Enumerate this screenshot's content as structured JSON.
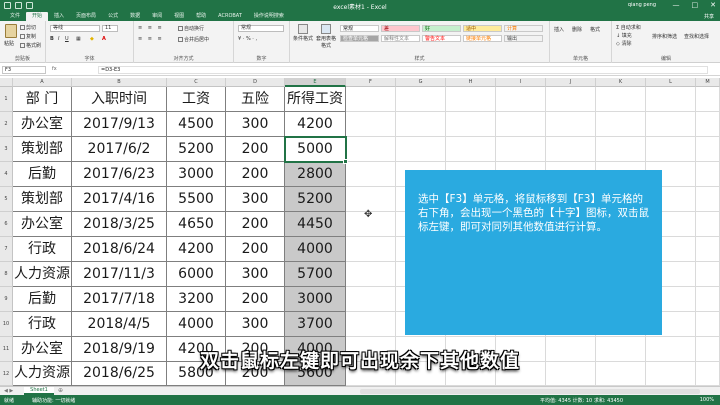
{
  "app": {
    "title": "excel素材1 - Excel",
    "user": "qiang peng",
    "window_controls": [
      "—",
      "□",
      "✕"
    ]
  },
  "ribbon": {
    "tabs": [
      "文件",
      "开始",
      "插入",
      "页面布局",
      "公式",
      "数据",
      "审阅",
      "视图",
      "帮助",
      "ACROBAT"
    ],
    "active_tab_index": 1,
    "tell_me": "操作说明搜索",
    "share": "共享",
    "clipboard": {
      "paste": "粘贴",
      "cut": "剪切",
      "copy": "复制",
      "format_painter": "格式刷",
      "label": "剪贴板"
    },
    "font": {
      "name": "等线",
      "size": "11",
      "label": "字体"
    },
    "alignment": {
      "wrap": "自动换行",
      "merge": "合并后居中",
      "label": "对齐方式"
    },
    "number": {
      "format": "常规",
      "label": "数字"
    },
    "styles": {
      "conditional": "条件格式",
      "table": "套用表格格式",
      "cells": [
        {
          "name": "常规",
          "bg": "#ffffff",
          "fg": "#222222"
        },
        {
          "name": "差",
          "bg": "#ffc7ce",
          "fg": "#9c0006"
        },
        {
          "name": "好",
          "bg": "#c6efce",
          "fg": "#006100"
        },
        {
          "name": "适中",
          "bg": "#ffeb9c",
          "fg": "#9c5700"
        },
        {
          "name": "计算",
          "bg": "#f2f2f2",
          "fg": "#fa7d00"
        },
        {
          "name": "检查单元格",
          "bg": "#a5a5a5",
          "fg": "#ffffff"
        },
        {
          "name": "解释性文本",
          "bg": "#ffffff",
          "fg": "#7f7f7f"
        },
        {
          "name": "警告文本",
          "bg": "#ffffff",
          "fg": "#ff0000"
        },
        {
          "name": "链接单元格",
          "bg": "#ffffff",
          "fg": "#fa7d00"
        },
        {
          "name": "输出",
          "bg": "#f2f2f2",
          "fg": "#3f3f3f"
        }
      ],
      "label": "样式"
    },
    "cells_group": {
      "insert": "插入",
      "delete": "删除",
      "format": "格式",
      "label": "单元格"
    },
    "editing": {
      "autosum": "自动求和",
      "fill": "填充",
      "clear": "清除",
      "sort": "排序和筛选",
      "find": "查找和选择",
      "label": "编辑"
    }
  },
  "formula_bar": {
    "name_box": "F3",
    "fx": "fx",
    "formula": "=D3-E3"
  },
  "columns": [
    "A",
    "B",
    "C",
    "D",
    "E",
    "F",
    "G",
    "H",
    "I",
    "J",
    "K",
    "L",
    "M",
    "N",
    "O",
    "P",
    "Q",
    "R"
  ],
  "rows": [
    "1",
    "2",
    "3",
    "4",
    "5",
    "6",
    "7",
    "8",
    "9",
    "10",
    "11",
    "12"
  ],
  "table": {
    "headers": [
      "部 门",
      "入职时间",
      "工资",
      "五险",
      "所得工资"
    ],
    "rows": [
      [
        "办公室",
        "2017/9/13",
        "4500",
        "300",
        "4200"
      ],
      [
        "策划部",
        "2017/6/2",
        "5200",
        "200",
        "5000"
      ],
      [
        "后勤",
        "2017/6/23",
        "3000",
        "200",
        "2800"
      ],
      [
        "策划部",
        "2017/4/16",
        "5500",
        "300",
        "5200"
      ],
      [
        "办公室",
        "2018/3/25",
        "4650",
        "200",
        "4450"
      ],
      [
        "行政",
        "2018/6/24",
        "4200",
        "200",
        "4000"
      ],
      [
        "人力资源",
        "2017/11/3",
        "6000",
        "300",
        "5700"
      ],
      [
        "后勤",
        "2017/7/18",
        "3200",
        "200",
        "3000"
      ],
      [
        "行政",
        "2018/4/5",
        "4000",
        "300",
        "3700"
      ],
      [
        "办公室",
        "2018/9/19",
        "4200",
        "200",
        "4000"
      ],
      [
        "人力资源",
        "2018/6/25",
        "5800",
        "200",
        "5600"
      ]
    ]
  },
  "note": {
    "text": "选中【F3】单元格，将鼠标移到【F3】单元格的右下角，会出现一个黑色的【十字】图标，双击鼠标左键，即可对同列其他数值进行计算。",
    "color": "#2aaae0"
  },
  "subtitle": "双击鼠标左键即可出现余下其他数值",
  "sheet_tabs": {
    "nav": "◀ ▶",
    "active": "Sheet1",
    "add": "⊕"
  },
  "status_bar": {
    "ready": "就绪",
    "mode": "辅助功能: 一切就绪",
    "stats": "平均值: 4345   计数: 10   求和: 43450",
    "zoom": "100%"
  },
  "colors": {
    "excel_green": "#217346",
    "selection_gray": "#c9c9c9"
  }
}
